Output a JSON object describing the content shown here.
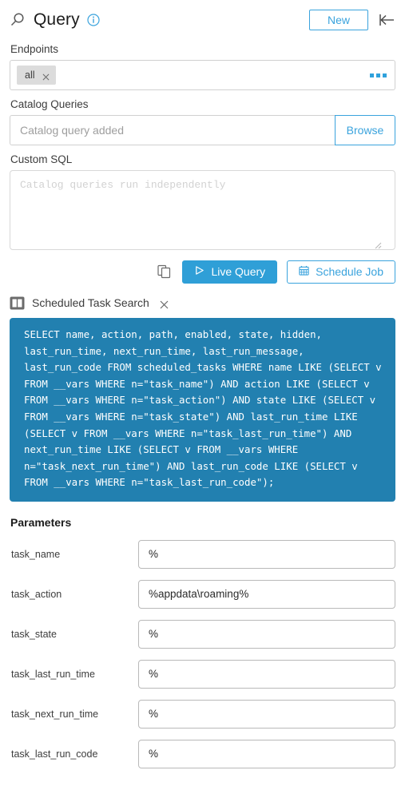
{
  "header": {
    "search_icon": "search-icon",
    "title": "Query",
    "info_icon": "info-icon",
    "new_label": "New",
    "collapse_icon": "collapse-left-icon"
  },
  "endpoints": {
    "label": "Endpoints",
    "chips": [
      {
        "label": "all",
        "remove_icon": "close-icon"
      }
    ],
    "more_icon": "ellipsis-icon"
  },
  "catalog_queries": {
    "label": "Catalog Queries",
    "value": "",
    "placeholder": "Catalog query added",
    "browse_label": "Browse"
  },
  "custom_sql": {
    "label": "Custom SQL",
    "value": "",
    "placeholder": "Catalog queries run independently",
    "resize_icon": "resize-grip-icon"
  },
  "actions": {
    "copy_icon": "copy-icon",
    "live_query_label": "Live Query",
    "live_query_icon": "play-icon",
    "schedule_job_label": "Schedule Job",
    "schedule_job_icon": "calendar-icon"
  },
  "tab": {
    "icon": "panels-icon",
    "label": "Scheduled Task Search",
    "close_icon": "close-icon"
  },
  "sql_block": {
    "text": "SELECT name, action, path, enabled, state, hidden, last_run_time, next_run_time, last_run_message, last_run_code FROM scheduled_tasks WHERE name LIKE (SELECT v FROM __vars WHERE n=\"task_name\") AND action LIKE (SELECT v FROM __vars WHERE n=\"task_action\") AND state LIKE (SELECT v FROM __vars WHERE n=\"task_state\") AND last_run_time LIKE (SELECT v FROM __vars WHERE n=\"task_last_run_time\") AND next_run_time LIKE (SELECT v FROM __vars WHERE n=\"task_next_run_time\") AND last_run_code LIKE (SELECT v FROM __vars WHERE n=\"task_last_run_code\");"
  },
  "parameters": {
    "title": "Parameters",
    "rows": [
      {
        "name": "task_name",
        "value": "%"
      },
      {
        "name": "task_action",
        "value": "%appdata\\roaming%"
      },
      {
        "name": "task_state",
        "value": "%"
      },
      {
        "name": "task_last_run_time",
        "value": "%"
      },
      {
        "name": "task_next_run_time",
        "value": "%"
      },
      {
        "name": "task_last_run_code",
        "value": "%"
      }
    ]
  },
  "colors": {
    "accent_blue": "#3aa3dd",
    "primary_blue": "#2f9fd7",
    "sql_block_blue": "#2280b0",
    "chip_gray": "#dcdcdc",
    "border_gray": "#d0d0d0"
  }
}
